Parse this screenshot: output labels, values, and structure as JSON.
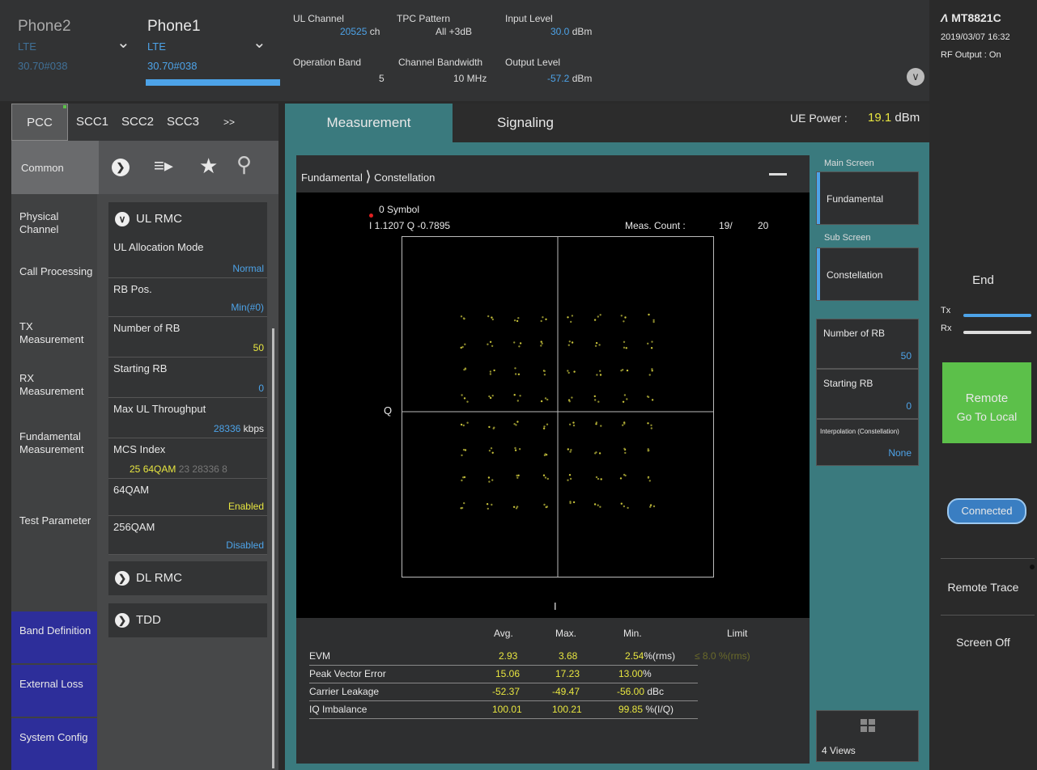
{
  "top": {
    "phone2": {
      "name": "Phone2",
      "tech": "LTE",
      "freq": "30.70#038"
    },
    "phone1": {
      "name": "Phone1",
      "tech": "LTE",
      "freq": "30.70#038"
    },
    "ul_channel": {
      "label": "UL Channel",
      "value": "20525",
      "unit": "ch"
    },
    "tpc_pattern": {
      "label": "TPC Pattern",
      "value": "All +3dB"
    },
    "input_level": {
      "label": "Input Level",
      "value": "30.0",
      "unit": "dBm"
    },
    "operation_band": {
      "label": "Operation Band",
      "value": "5"
    },
    "channel_bandwidth": {
      "label": "Channel Bandwidth",
      "value": "10 MHz"
    },
    "output_level": {
      "label": "Output Level",
      "value": "-57.2",
      "unit": "dBm"
    }
  },
  "brand": {
    "name": "MT8821C",
    "datetime": "2019/03/07 16:32",
    "rf_output": "RF Output : On"
  },
  "carrier_tabs": [
    "PCC",
    "SCC1",
    "SCC2",
    "SCC3",
    ">>"
  ],
  "common_label": "Common",
  "nav": [
    "Physical Channel",
    "Call Processing",
    "TX Measurement",
    "RX Measurement",
    "Fundamental Measurement",
    "Test Parameter",
    "Band Definition",
    "External Loss",
    "System Config"
  ],
  "ul_rmc": {
    "title": "UL RMC",
    "rows": [
      {
        "label": "UL Allocation Mode",
        "value": "Normal"
      },
      {
        "label": "RB Pos.",
        "value": "Min(#0)"
      },
      {
        "label": "Number of RB",
        "value": "50"
      },
      {
        "label": "Starting RB",
        "value": "0"
      },
      {
        "label": "Max UL Throughput",
        "value": "28336",
        "unit": "kbps"
      },
      {
        "label": "MCS Index",
        "value_a": "25",
        "value_b": "64QAM",
        "value_c": "23  28336  8"
      },
      {
        "label": "64QAM",
        "value": "Enabled"
      },
      {
        "label": "256QAM",
        "value": "Disabled"
      }
    ]
  },
  "dl_rmc": "DL RMC",
  "tdd": "TDD",
  "tabs": {
    "measurement": "Measurement",
    "signaling": "Signaling"
  },
  "ue_power": {
    "label": "UE Power :",
    "value": "19.1",
    "unit": "dBm"
  },
  "breadcrumb": {
    "a": "Fundamental",
    "b": "Constellation"
  },
  "plot": {
    "symbol": "0 Symbol",
    "iq": "I 1.1207 Q -0.7895",
    "meas_count_label": "Meas. Count :",
    "meas_count": "19/",
    "meas_total": "20",
    "q_axis": "Q",
    "i_axis": "I"
  },
  "results": {
    "headers": [
      "Avg.",
      "Max.",
      "Min.",
      "Limit"
    ],
    "rows": [
      {
        "name": "EVM",
        "avg": "2.93",
        "max": "3.68",
        "min": "2.54",
        "unit": "%(rms)",
        "limit": "≤ 8.0 %(rms)"
      },
      {
        "name": "Peak Vector Error",
        "avg": "15.06",
        "max": "17.23",
        "min": "13.00",
        "unit": "%",
        "limit": ""
      },
      {
        "name": "Carrier Leakage",
        "avg": "-52.37",
        "max": "-49.47",
        "min": "-56.00",
        "unit": "dBc",
        "limit": ""
      },
      {
        "name": "IQ Imbalance",
        "avg": "100.01",
        "max": "100.21",
        "min": "99.85",
        "unit": "%(I/Q)",
        "limit": ""
      }
    ]
  },
  "right_panel": {
    "main_screen": "Main Screen",
    "fundamental": "Fundamental",
    "sub_screen": "Sub Screen",
    "constellation": "Constellation",
    "number_of_rb": {
      "label": "Number of RB",
      "value": "50"
    },
    "starting_rb": {
      "label": "Starting RB",
      "value": "0"
    },
    "interpolation": {
      "label": "Interpolation (Constellation)",
      "value": "None"
    },
    "views": "4 Views"
  },
  "far_right": {
    "end": "End",
    "tx": "Tx",
    "rx": "Rx",
    "remote": "Remote",
    "go_to_local": "Go To Local",
    "connected": "Connected",
    "remote_trace": "Remote Trace",
    "screen_off": "Screen Off"
  },
  "colors": {
    "accent_blue": "#4da3e8",
    "value_yellow": "#e8e640",
    "panel_teal": "#3a7a7e",
    "remote_green": "#5cc04a"
  }
}
